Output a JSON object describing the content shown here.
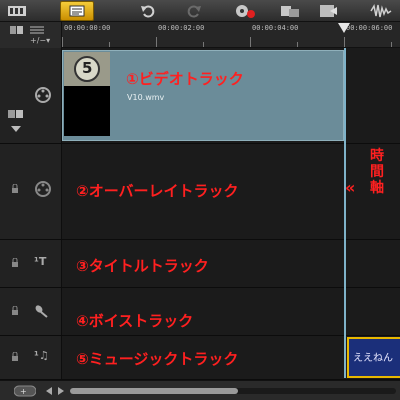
{
  "timeline": {
    "ticks": [
      "00:00:00:00",
      "00:00:02:00",
      "00:00:04:00",
      "00:00:06:00"
    ]
  },
  "toolbar": {
    "buttons": [
      "storyboard-view-icon",
      "timeline-view-icon",
      "undo-icon",
      "redo-icon",
      "record-capture-icon",
      "automix-icon",
      "mix-icon",
      "audio-wave-icon"
    ]
  },
  "tracks": {
    "video": {
      "label": "①ビデオトラック",
      "clip_name": "V10.wmv",
      "thumb_number": "5"
    },
    "overlay": {
      "label": "②オーバーレイトラック"
    },
    "title": {
      "label": "③タイトルトラック"
    },
    "voice": {
      "label": "④ボイストラック"
    },
    "music": {
      "label": "⑤ミュージックトラック",
      "clip_text": "ええねん"
    }
  },
  "annotation": {
    "playhead_label": "時間軸",
    "arrow": "«"
  },
  "colors": {
    "label_red": "#ff2020",
    "clip_blue": "#6b8c99",
    "music_clip": "#1b2f7a",
    "music_border": "#e8b800",
    "active_tab": "#f5cc3a"
  }
}
